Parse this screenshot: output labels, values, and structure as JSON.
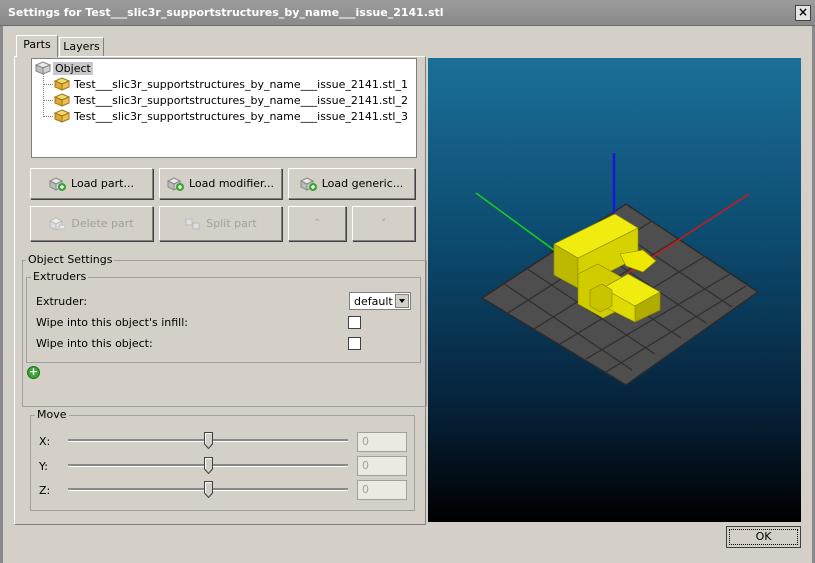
{
  "window": {
    "title": "Settings for Test___slic3r_supportstructures_by_name___issue_2141.stl",
    "close_glyph": "×"
  },
  "tabs": [
    {
      "label": "Parts",
      "active": true
    },
    {
      "label": "Layers",
      "active": false
    }
  ],
  "tree": {
    "root": "Object",
    "items": [
      "Test___slic3r_supportstructures_by_name___issue_2141.stl_1",
      "Test___slic3r_supportstructures_by_name___issue_2141.stl_2",
      "Test___slic3r_supportstructures_by_name___issue_2141.stl_3"
    ]
  },
  "buttons": {
    "load_part": "Load part...",
    "load_modifier": "Load modifier...",
    "load_generic": "Load generic...",
    "delete_part": "Delete part",
    "split_part": "Split part",
    "move_up": "˄",
    "move_down": "˅"
  },
  "object_settings": {
    "title": "Object Settings",
    "extruders": {
      "title": "Extruders",
      "extruder_label": "Extruder:",
      "extruder_value": "default",
      "wipe_infill_label": "Wipe into this object's infill:",
      "wipe_infill_checked": false,
      "wipe_object_label": "Wipe into this object:",
      "wipe_object_checked": false
    },
    "add_icon": "+"
  },
  "move": {
    "title": "Move",
    "axes": [
      {
        "label": "X:",
        "value": "0"
      },
      {
        "label": "Y:",
        "value": "0"
      },
      {
        "label": "Z:",
        "value": "0"
      }
    ]
  },
  "ok_button": "OK",
  "colors": {
    "part_yellow": "#e4e000",
    "axis_x": "#d01818",
    "axis_y": "#18d018",
    "axis_z": "#1818d8",
    "bed_grey": "#505050"
  }
}
